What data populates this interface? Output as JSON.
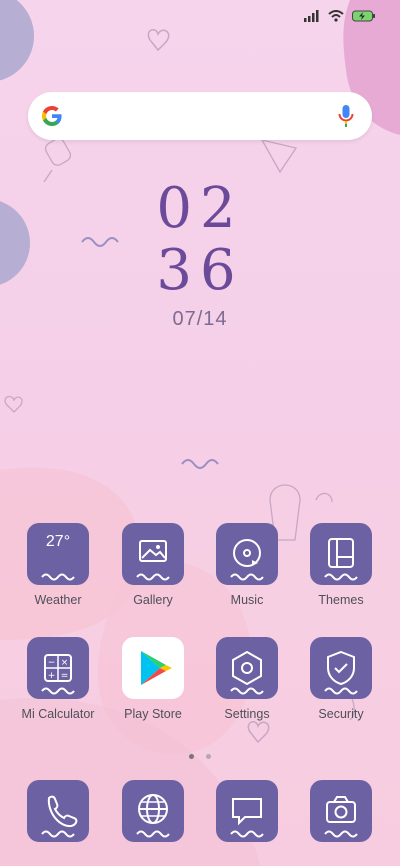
{
  "status": {
    "signal_icon": "signal-icon",
    "wifi_icon": "wifi-icon",
    "battery_icon": "battery-charging-icon"
  },
  "search": {
    "logo_icon": "google-g-icon",
    "mic_icon": "microphone-icon"
  },
  "clock": {
    "hour": "02",
    "minute": "36",
    "date": "07/14"
  },
  "apps_row1": [
    {
      "label": "Weather",
      "temp": "27°"
    },
    {
      "label": "Gallery"
    },
    {
      "label": "Music"
    },
    {
      "label": "Themes"
    }
  ],
  "apps_row2": [
    {
      "label": "Mi Calculator"
    },
    {
      "label": "Play Store"
    },
    {
      "label": "Settings"
    },
    {
      "label": "Security"
    }
  ],
  "dock": {
    "phone_icon": "phone-icon",
    "browser_icon": "globe-icon",
    "messages_icon": "message-icon",
    "camera_icon": "camera-icon"
  },
  "colors": {
    "tile": "#6c62a3",
    "clock": "#6c4a9a",
    "bg": "#f6d4ec"
  }
}
